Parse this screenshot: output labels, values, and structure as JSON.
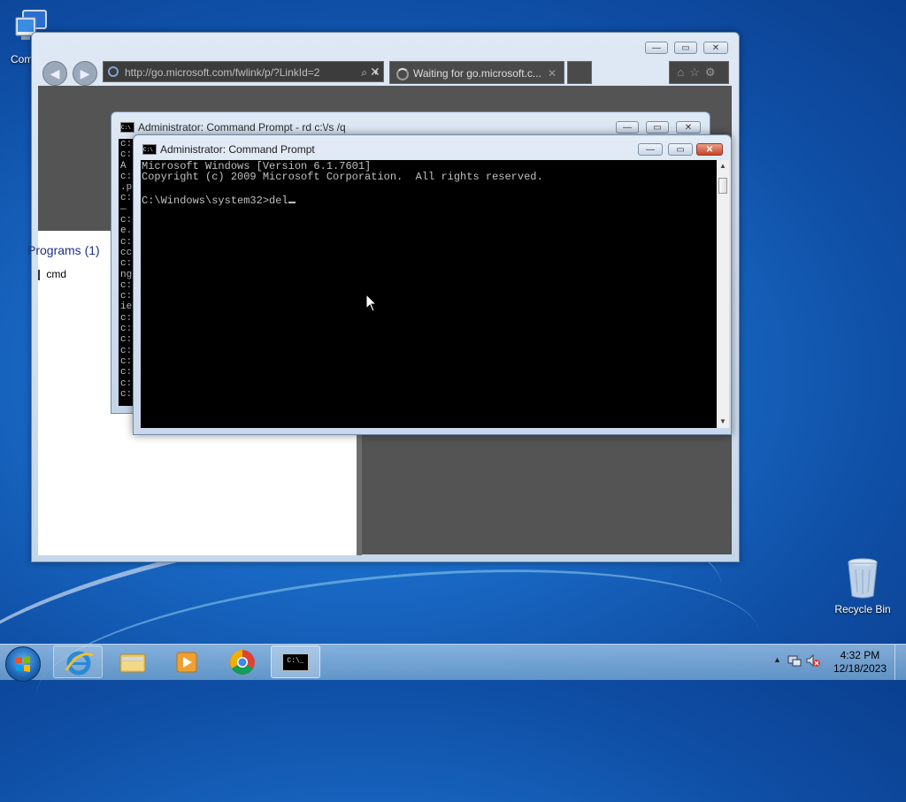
{
  "desktop": {
    "computer_label": "Computer",
    "recycle_bin_label": "Recycle Bin"
  },
  "browser": {
    "address_url": "http://go.microsoft.com/fwlink/p/?LinkId=2",
    "tab_title": "Waiting for go.microsoft.c...",
    "start_section_header": "Programs (1)",
    "start_result_item": "cmd"
  },
  "back_console": {
    "title": "Administrator:  Command Prompt - rd  c:\\/s /q",
    "visible_line_starts": [
      "c:",
      "c:",
      "A",
      "c:",
      ".p",
      "c:",
      "—",
      "c:",
      "e.",
      "c:",
      "cc",
      "c:",
      "ng",
      "c:",
      "c:",
      "ie",
      "c:",
      "c:",
      "c:",
      "c:",
      "c:",
      "c:",
      "c:",
      "c:"
    ]
  },
  "front_console": {
    "title": "Administrator:  Command Prompt",
    "lines": [
      "Microsoft Windows [Version 6.1.7601]",
      "Copyright (c) 2009 Microsoft Corporation.  All rights reserved.",
      "",
      "C:\\Windows\\system32>del"
    ]
  },
  "window_controls": {
    "minimize": "—",
    "maximize": "▭",
    "close": "✕"
  },
  "taskbar": {
    "time": "4:32 PM",
    "date": "12/18/2023",
    "cmd_button_glyph": "C:\\_"
  },
  "icons": {
    "computer": "computer-icon",
    "recycle_bin": "recycle-bin-icon",
    "ie": "internet-explorer-icon",
    "explorer": "file-explorer-icon",
    "media": "media-player-icon",
    "chrome": "chrome-icon",
    "cmd": "command-prompt-icon"
  },
  "colors": {
    "console_bg": "#000000",
    "console_text": "#c0c0c0",
    "close_button": "#c6452a",
    "desktop_blue": "#1a6cc8"
  }
}
